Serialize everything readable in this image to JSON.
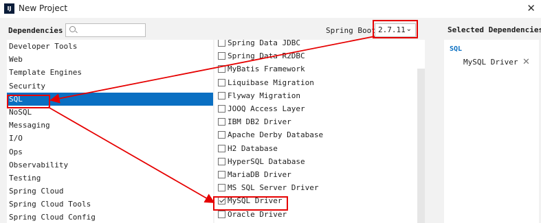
{
  "window": {
    "title": "New Project",
    "icon": "IJ",
    "close_icon": "✕"
  },
  "dependencies_label": "Dependencies",
  "search": {
    "placeholder": ""
  },
  "spring_boot": {
    "label": "Spring Boot",
    "version": "2.7.11"
  },
  "categories": [
    "Developer Tools",
    "Web",
    "Template Engines",
    "Security",
    "SQL",
    "NoSQL",
    "Messaging",
    "I/O",
    "Ops",
    "Observability",
    "Testing",
    "Spring Cloud",
    "Spring Cloud Tools",
    "Spring Cloud Config"
  ],
  "selected_category": "SQL",
  "dependencies": [
    {
      "label": "Spring Data JDBC",
      "checked": false
    },
    {
      "label": "Spring Data R2DBC",
      "checked": false
    },
    {
      "label": "MyBatis Framework",
      "checked": false
    },
    {
      "label": "Liquibase Migration",
      "checked": false
    },
    {
      "label": "Flyway Migration",
      "checked": false
    },
    {
      "label": "JOOQ Access Layer",
      "checked": false
    },
    {
      "label": "IBM DB2 Driver",
      "checked": false
    },
    {
      "label": "Apache Derby Database",
      "checked": false
    },
    {
      "label": "H2 Database",
      "checked": false
    },
    {
      "label": "HyperSQL Database",
      "checked": false
    },
    {
      "label": "MariaDB Driver",
      "checked": false
    },
    {
      "label": "MS SQL Server Driver",
      "checked": false
    },
    {
      "label": "MySQL Driver",
      "checked": true
    },
    {
      "label": "Oracle Driver",
      "checked": false
    }
  ],
  "selected_dependencies": {
    "title": "Selected Dependencies",
    "group": "SQL",
    "items": [
      {
        "label": "MySQL Driver",
        "remove_icon": "✕"
      }
    ]
  },
  "colors": {
    "selection": "#0a6fc2",
    "highlight": "#e60000"
  }
}
